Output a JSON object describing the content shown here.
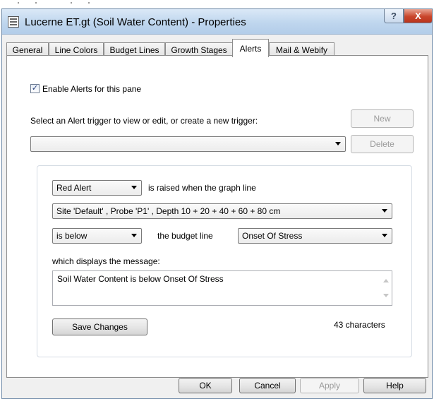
{
  "window": {
    "title": "Lucerne ET.gt (Soil Water Content) - Properties",
    "help_glyph": "?",
    "close_glyph": "X"
  },
  "tabs": [
    {
      "label": "General"
    },
    {
      "label": "Line Colors"
    },
    {
      "label": "Budget Lines"
    },
    {
      "label": "Growth Stages"
    },
    {
      "label": "Alerts"
    },
    {
      "label": "Mail & Webify"
    }
  ],
  "alerts": {
    "enable_label": "Enable Alerts for this pane",
    "enable_checked": true,
    "check_glyph": "✓",
    "select_prompt": "Select an Alert trigger to view or edit, or create a new trigger:",
    "new_label": "New",
    "delete_label": "Delete",
    "trigger_value": "",
    "alert_level": "Red Alert",
    "raised_text": "is raised when the graph line",
    "series_value": "Site 'Default' , Probe 'P1' , Depth 10 + 20 + 40 + 60 + 80 cm",
    "condition_value": "is below",
    "budget_text": "the budget line",
    "budget_value": "Onset Of Stress",
    "message_label": "which displays the message:",
    "message_value": "Soil Water Content is below Onset Of Stress",
    "save_label": "Save Changes",
    "char_count": "43 characters"
  },
  "footer": {
    "ok_label": "OK",
    "cancel_label": "Cancel",
    "apply_label": "Apply",
    "help_label": "Help"
  }
}
